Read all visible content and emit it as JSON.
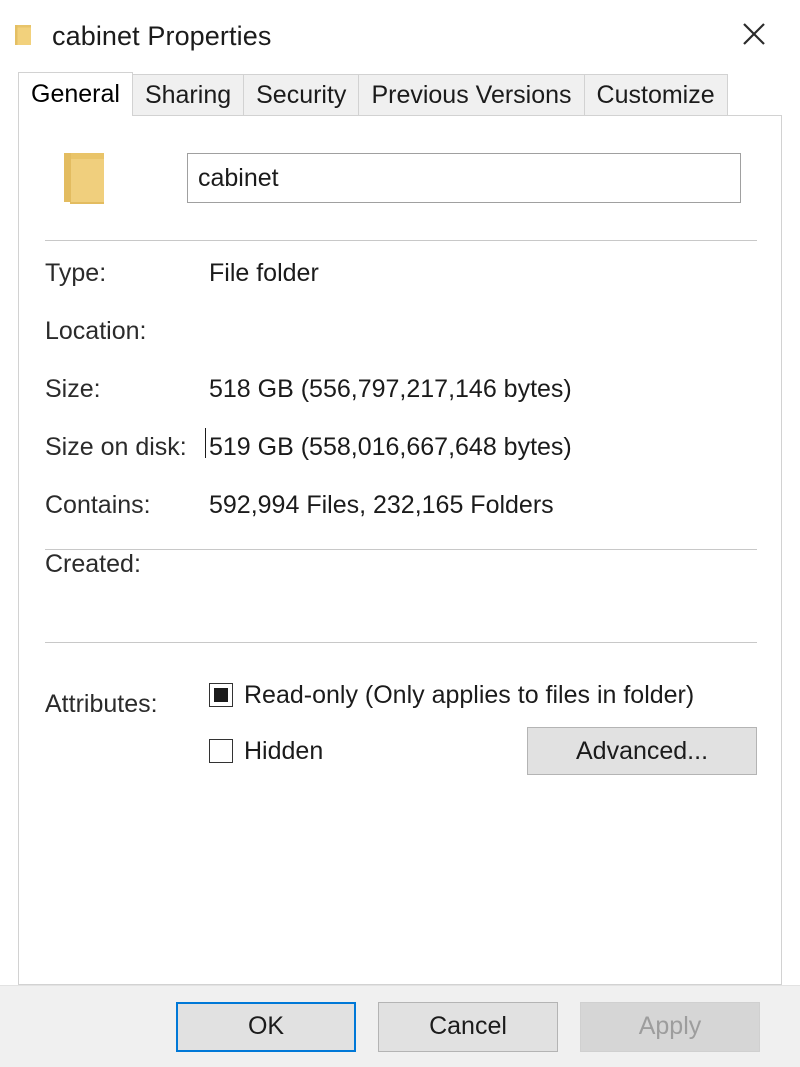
{
  "window": {
    "title": "cabinet Properties",
    "icon": "folder-icon",
    "close_label": "✕"
  },
  "tabs": [
    {
      "label": "General",
      "active": true
    },
    {
      "label": "Sharing",
      "active": false
    },
    {
      "label": "Security",
      "active": false
    },
    {
      "label": "Previous Versions",
      "active": false
    },
    {
      "label": "Customize",
      "active": false
    }
  ],
  "general": {
    "folder_icon": "folder-icon",
    "name_value": "cabinet",
    "name_placeholder": "",
    "properties": [
      {
        "label": "Type:",
        "value": "File folder"
      },
      {
        "label": "Location:",
        "value": ""
      },
      {
        "label": "Size:",
        "value": "518 GB (556,797,217,146 bytes)"
      },
      {
        "label": "Size on disk:",
        "value": "519 GB (558,016,667,648 bytes)"
      },
      {
        "label": "Contains:",
        "value": "592,994 Files, 232,165 Folders"
      }
    ],
    "created": {
      "label": "Created:",
      "value": ""
    },
    "attributes": {
      "label": "Attributes:",
      "readonly": {
        "label": "Read-only (Only applies to files in folder)",
        "state": "indeterminate"
      },
      "hidden": {
        "label": "Hidden",
        "state": "unchecked"
      },
      "advanced_label": "Advanced..."
    }
  },
  "footer": {
    "ok_label": "OK",
    "cancel_label": "Cancel",
    "apply_label": "Apply"
  },
  "colors": {
    "accent": "#0078d7",
    "folder": "#f2d17c",
    "panel_border": "#d2d2d2",
    "footer_bg": "#f0f0f0"
  }
}
